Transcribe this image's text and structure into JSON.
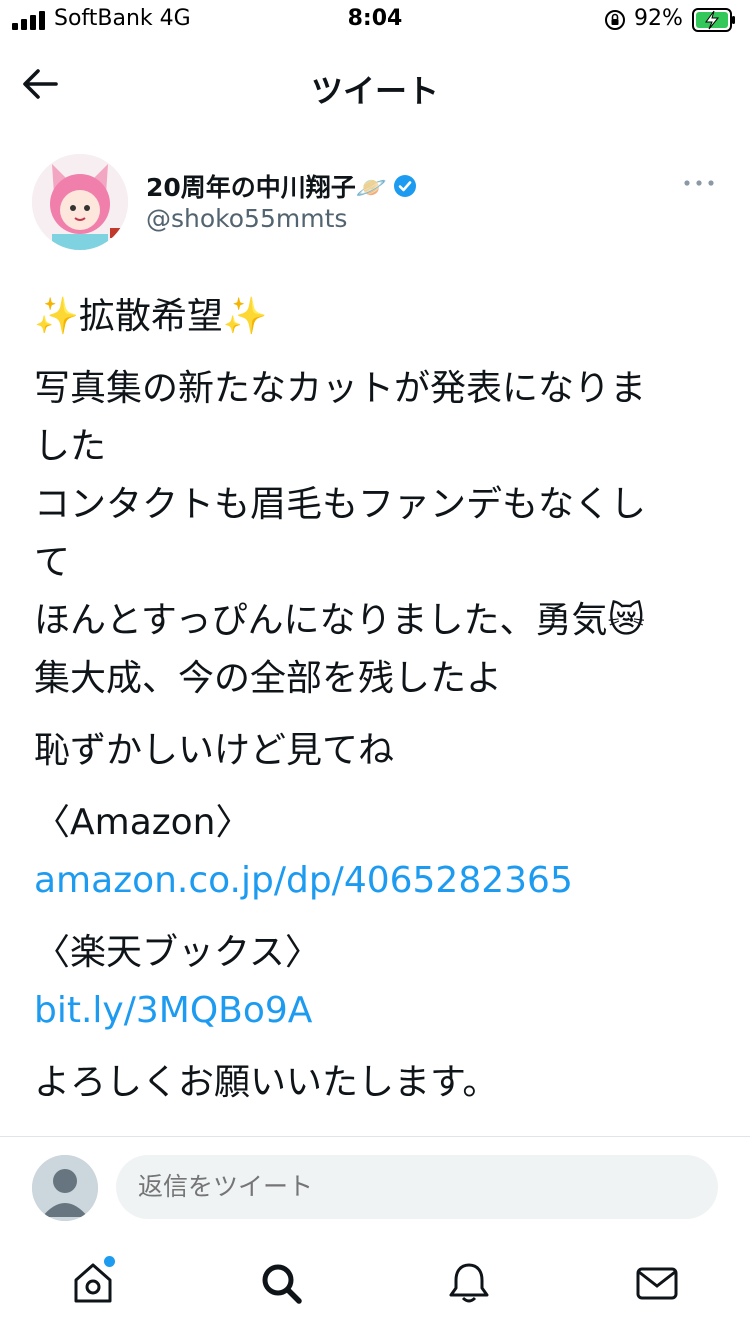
{
  "status_bar": {
    "carrier": "SoftBank  4G",
    "time": "8:04",
    "battery": "92%"
  },
  "header": {
    "title": "ツイート"
  },
  "author": {
    "display_name": "20周年の中川翔子🪐",
    "handle": "@shoko55mmts",
    "verified": true
  },
  "tweet": {
    "paragraphs": [
      [
        "✨拡散希望✨"
      ],
      [
        "写真集の新たなカットが発表になりま",
        "した",
        "コンタクトも眉毛もファンデもなくし",
        "て",
        "ほんとすっぴんになりました、勇気😿",
        "集大成、今の全部を残したよ"
      ],
      [
        "恥ずかしいけど見てね"
      ],
      [
        "〈Amazon〉"
      ],
      [
        "〈楽天ブックス〉"
      ],
      [
        "よろしくお願いいたします。"
      ]
    ],
    "amazon_link": "amazon.co.jp/dp/4065282365",
    "rakuten_link": "bit.ly/3MQBo9A"
  },
  "reply": {
    "placeholder": "返信をツイート"
  },
  "tabs": [
    "home-icon",
    "search-icon",
    "notifications-icon",
    "messages-icon"
  ],
  "colors": {
    "accent": "#1d9bf0",
    "text": "#0f1419",
    "secondary_text": "#536471",
    "input_bg": "#eff3f4"
  }
}
